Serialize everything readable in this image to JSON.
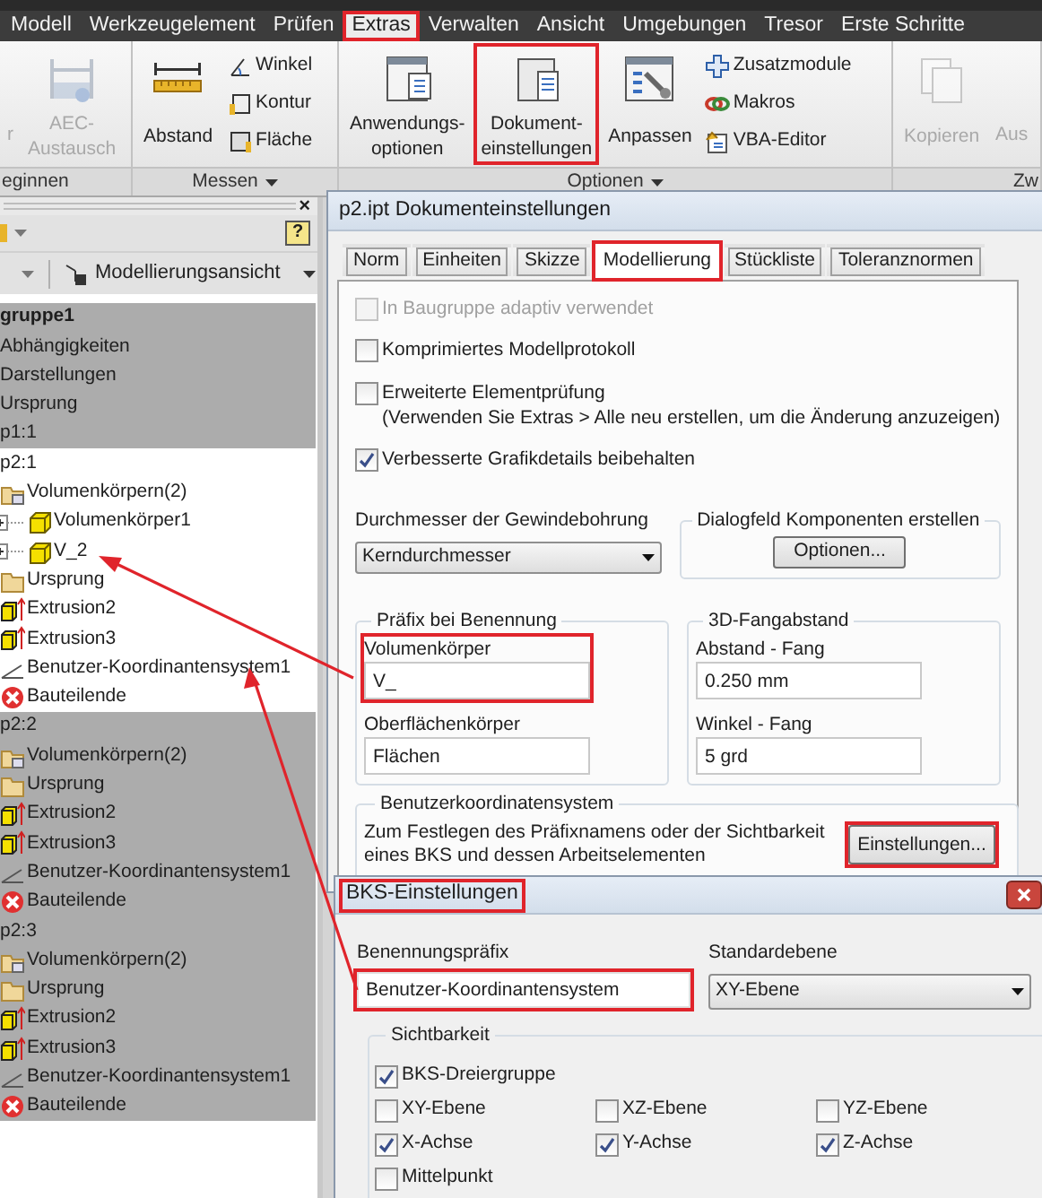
{
  "menu_tabs": [
    {
      "label": "Modell",
      "selected": false
    },
    {
      "label": "Werkzeugelement",
      "selected": false
    },
    {
      "label": "Prüfen",
      "selected": false
    },
    {
      "label": "Extras",
      "selected": true
    },
    {
      "label": "Verwalten",
      "selected": false
    },
    {
      "label": "Ansicht",
      "selected": false
    },
    {
      "label": "Umgebungen",
      "selected": false
    },
    {
      "label": "Tresor",
      "selected": false
    },
    {
      "label": "Erste Schritte",
      "selected": false
    }
  ],
  "ribbon": {
    "groups": [
      {
        "label": "eginnen",
        "dropdown": false,
        "items": [
          {
            "kind": "large",
            "label": "r",
            "disabled": true,
            "annotated": false
          },
          {
            "kind": "large",
            "label": "AEC-\nAustausch",
            "disabled": true,
            "annotated": false
          }
        ]
      },
      {
        "label": "Messen",
        "dropdown": true,
        "items": [
          {
            "kind": "large",
            "label": "Abstand",
            "disabled": false,
            "annotated": false
          },
          {
            "kind": "small",
            "label": "Winkel",
            "disabled": false,
            "annotated": false
          },
          {
            "kind": "small",
            "label": "Kontur",
            "disabled": false,
            "annotated": false
          },
          {
            "kind": "small",
            "label": "Fläche",
            "disabled": false,
            "annotated": false
          }
        ]
      },
      {
        "label": "Optionen",
        "dropdown": true,
        "items": [
          {
            "kind": "large",
            "label": "Anwendungs-\noptionen",
            "disabled": false,
            "annotated": false
          },
          {
            "kind": "large",
            "label": "Dokument-\neinstellungen",
            "disabled": false,
            "annotated": true
          },
          {
            "kind": "large",
            "label": "Anpassen",
            "disabled": false,
            "annotated": false
          },
          {
            "kind": "small",
            "label": "Zusatzmodule",
            "disabled": false,
            "annotated": false
          },
          {
            "kind": "small",
            "label": "Makros",
            "disabled": false,
            "annotated": false
          },
          {
            "kind": "small",
            "label": "VBA-Editor",
            "disabled": false,
            "annotated": false
          }
        ]
      },
      {
        "label": "Zw",
        "dropdown": false,
        "items": [
          {
            "kind": "large",
            "label": "Kopieren",
            "disabled": true,
            "annotated": false
          },
          {
            "kind": "large",
            "label": "Aus",
            "disabled": true,
            "annotated": false
          }
        ]
      }
    ]
  },
  "browser": {
    "close": "×",
    "help": "?",
    "view": "Modellierungsansicht",
    "tree": [
      {
        "label": "gruppe1",
        "selected": true,
        "children": [
          {
            "label": "Abhängigkeiten",
            "selected": true
          },
          {
            "label": "Darstellungen",
            "selected": true
          },
          {
            "label": "Ursprung",
            "selected": true
          },
          {
            "label": "p1:1",
            "selected": true
          },
          {
            "label": "p2:1",
            "selected": false,
            "children": [
              {
                "label": "Volumenkörpern(2)",
                "kind": "bodies",
                "selected": false,
                "children": [
                  {
                    "label": "Volumenkörper1",
                    "kind": "body",
                    "selected": false
                  },
                  {
                    "label": "V_2",
                    "kind": "body",
                    "selected": false
                  }
                ]
              },
              {
                "label": "Ursprung",
                "kind": "folder",
                "selected": false
              },
              {
                "label": "Extrusion2",
                "kind": "extrusion",
                "selected": false
              },
              {
                "label": "Extrusion3",
                "kind": "extrusion",
                "selected": false
              },
              {
                "label": "Benutzer-Koordinantensystem1",
                "kind": "ucs",
                "selected": false
              },
              {
                "label": "Bauteilende",
                "kind": "end",
                "selected": false
              }
            ]
          },
          {
            "label": "p2:2",
            "selected": true,
            "children": [
              {
                "label": "Volumenkörpern(2)",
                "kind": "bodies",
                "selected": true
              },
              {
                "label": "Ursprung",
                "kind": "folder",
                "selected": true
              },
              {
                "label": "Extrusion2",
                "kind": "extrusion",
                "selected": true
              },
              {
                "label": "Extrusion3",
                "kind": "extrusion",
                "selected": true
              },
              {
                "label": "Benutzer-Koordinantensystem1",
                "kind": "ucs",
                "selected": true
              },
              {
                "label": "Bauteilende",
                "kind": "end",
                "selected": true
              }
            ]
          },
          {
            "label": "p2:3",
            "selected": true,
            "children": [
              {
                "label": "Volumenkörpern(2)",
                "kind": "bodies",
                "selected": true
              },
              {
                "label": "Ursprung",
                "kind": "folder",
                "selected": true
              },
              {
                "label": "Extrusion2",
                "kind": "extrusion",
                "selected": true
              },
              {
                "label": "Extrusion3",
                "kind": "extrusion",
                "selected": true
              },
              {
                "label": "Benutzer-Koordinantensystem1",
                "kind": "ucs",
                "selected": true
              },
              {
                "label": "Bauteilende",
                "kind": "end",
                "selected": true
              }
            ]
          }
        ]
      }
    ]
  },
  "document_settings": {
    "title": "p2.ipt Dokumenteinstellungen",
    "tabs": [
      {
        "label": "Norm",
        "selected": false,
        "annotated": false
      },
      {
        "label": "Einheiten",
        "selected": false,
        "annotated": false
      },
      {
        "label": "Skizze",
        "selected": false,
        "annotated": false
      },
      {
        "label": "Modellierung",
        "selected": true,
        "annotated": true
      },
      {
        "label": "Stückliste",
        "selected": false,
        "annotated": false
      },
      {
        "label": "Toleranznormen",
        "selected": false,
        "annotated": false
      }
    ],
    "options": [
      {
        "label": "In Baugruppe adaptiv verwendet",
        "checked": false,
        "disabled": true
      },
      {
        "label": "Komprimiertes Modellprotokoll",
        "checked": false,
        "disabled": false
      },
      {
        "label": "Erweiterte Elementprüfung",
        "note": "(Verwenden Sie Extras > Alle neu erstellen, um die Änderung anzuzeigen)",
        "checked": false,
        "disabled": false
      },
      {
        "label": "Verbesserte Grafikdetails beibehalten",
        "checked": true,
        "disabled": false
      }
    ],
    "thread_diameter": {
      "label": "Durchmesser der Gewindebohrung",
      "value": "Kerndurchmesser"
    },
    "component_dialog": {
      "title": "Dialogfeld Komponenten erstellen",
      "button": "Optionen..."
    },
    "naming_prefix": {
      "title": "Präfix bei Benennung",
      "fields": [
        {
          "label": "Volumenkörper",
          "value": "V_",
          "annotated": true
        },
        {
          "label": "Oberflächenkörper",
          "value": "Flächen",
          "annotated": false
        }
      ]
    },
    "snap": {
      "title": "3D-Fangabstand",
      "fields": [
        {
          "label": "Abstand - Fang",
          "value": "0.250 mm"
        },
        {
          "label": "Winkel - Fang",
          "value": "5 grd"
        }
      ]
    },
    "ucs": {
      "title": "Benutzerkoordinatensystem",
      "text": "Zum Festlegen des Präfixnamens oder der Sichtbarkeit eines BKS und dessen Arbeitselementen",
      "button": "Einstellungen...",
      "button_annotated": true
    }
  },
  "bks_settings": {
    "title": "BKS-Einstellungen",
    "title_annotated": true,
    "prefix": {
      "label": "Benennungspräfix",
      "value": "Benutzer-Koordinantensystem",
      "annotated": true
    },
    "default_plane": {
      "label": "Standardebene",
      "value": "XY-Ebene"
    },
    "visibility": {
      "title": "Sichtbarkeit",
      "options": [
        {
          "label": "BKS-Dreiergruppe",
          "checked": true
        },
        {
          "label": "XY-Ebene",
          "checked": false
        },
        {
          "label": "XZ-Ebene",
          "checked": false
        },
        {
          "label": "YZ-Ebene",
          "checked": false
        },
        {
          "label": "X-Achse",
          "checked": true
        },
        {
          "label": "Y-Achse",
          "checked": true
        },
        {
          "label": "Z-Achse",
          "checked": true
        },
        {
          "label": "Mittelpunkt",
          "checked": false
        }
      ]
    }
  }
}
